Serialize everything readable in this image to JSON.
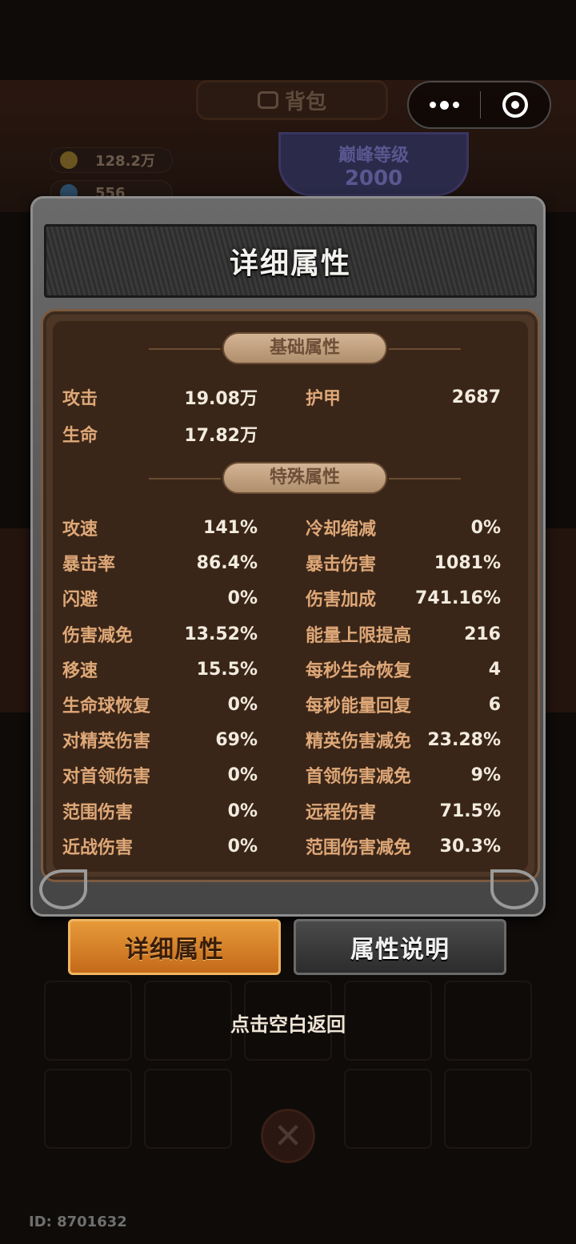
{
  "background": {
    "tab_label": "背包",
    "coins": "128.2万",
    "gems": "556",
    "level_label": "巅峰等级",
    "level_value": "2000"
  },
  "capsule": {
    "more_icon": "more-dots-icon",
    "close_icon": "target-circle-icon"
  },
  "dialog": {
    "title": "详细属性",
    "basic_section": "基础属性",
    "special_section": "特殊属性",
    "basic_stats": [
      {
        "name": "攻击",
        "value": "19.08万"
      },
      {
        "name": "护甲",
        "value": "2687"
      },
      {
        "name": "生命",
        "value": "17.82万"
      }
    ],
    "special_left": [
      {
        "name": "攻速",
        "value": "141%"
      },
      {
        "name": "暴击率",
        "value": "86.4%"
      },
      {
        "name": "闪避",
        "value": "0%"
      },
      {
        "name": "伤害减免",
        "value": "13.52%"
      },
      {
        "name": "移速",
        "value": "15.5%"
      },
      {
        "name": "生命球恢复",
        "value": "0%"
      },
      {
        "name": "对精英伤害",
        "value": "69%"
      },
      {
        "name": "对首领伤害",
        "value": "0%"
      },
      {
        "name": "范围伤害",
        "value": "0%"
      },
      {
        "name": "近战伤害",
        "value": "0%"
      }
    ],
    "special_right": [
      {
        "name": "冷却缩减",
        "value": "0%"
      },
      {
        "name": "暴击伤害",
        "value": "1081%"
      },
      {
        "name": "伤害加成",
        "value": "741.16%"
      },
      {
        "name": "能量上限提高",
        "value": "216"
      },
      {
        "name": "每秒生命恢复",
        "value": "4"
      },
      {
        "name": "每秒能量回复",
        "value": "6"
      },
      {
        "name": "精英伤害减免",
        "value": "23.28%"
      },
      {
        "name": "首领伤害减免",
        "value": "9%"
      },
      {
        "name": "远程伤害",
        "value": "71.5%"
      },
      {
        "name": "范围伤害减免",
        "value": "30.3%"
      }
    ]
  },
  "buttons": {
    "detail": "详细属性",
    "description": "属性说明"
  },
  "hint": "点击空白返回",
  "footer_id": "ID: 8701632",
  "colors": {
    "accent": "#e08a2c",
    "stat_name": "#dfa878",
    "stat_value": "#f2ebdf"
  }
}
